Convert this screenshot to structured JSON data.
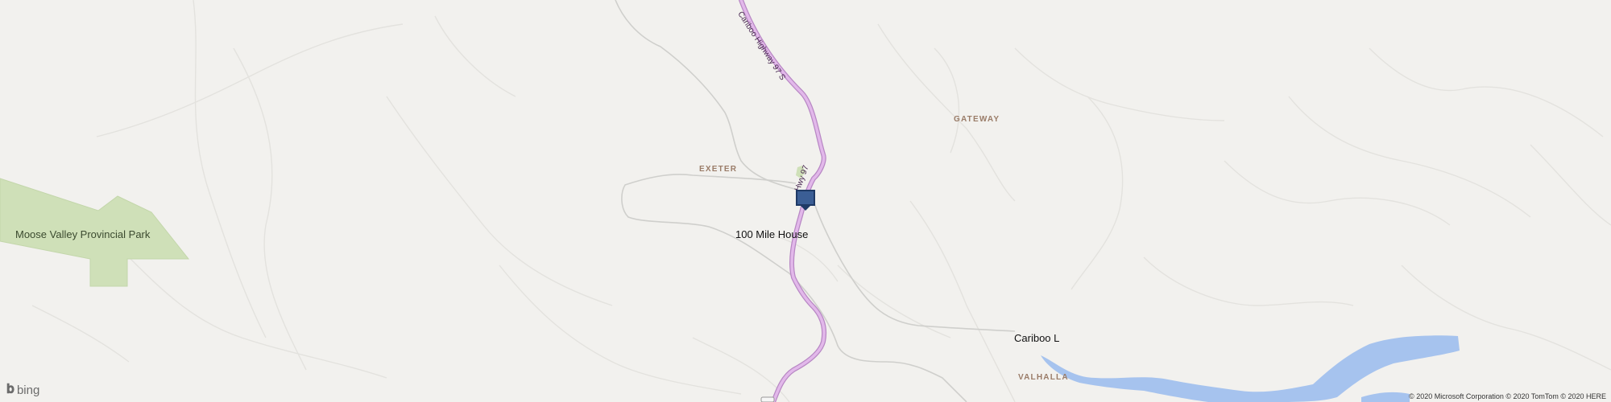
{
  "places": {
    "town_main": "100 Mile House",
    "town_cariboo": "Cariboo L",
    "locality_gateway": "GATEWAY",
    "locality_exeter": "EXETER",
    "locality_valhalla": "VALHALLA",
    "park": "Moose Valley Provincial Park"
  },
  "roads": {
    "highway_label_1": "Cariboo Highway 97 S",
    "highway_label_2": "Hwy 97"
  },
  "marker": {
    "icon": "location-pin-icon"
  },
  "footer": {
    "logo_text": "bing",
    "copyright": "© 2020 Microsoft Corporation © 2020 TomTom © 2020 HERE"
  },
  "colors": {
    "background": "#f2f1ee",
    "park": "#cfe0b8",
    "water": "#a6c3ee",
    "highway": "#d7a7e1",
    "marker": "#3b5e95"
  }
}
